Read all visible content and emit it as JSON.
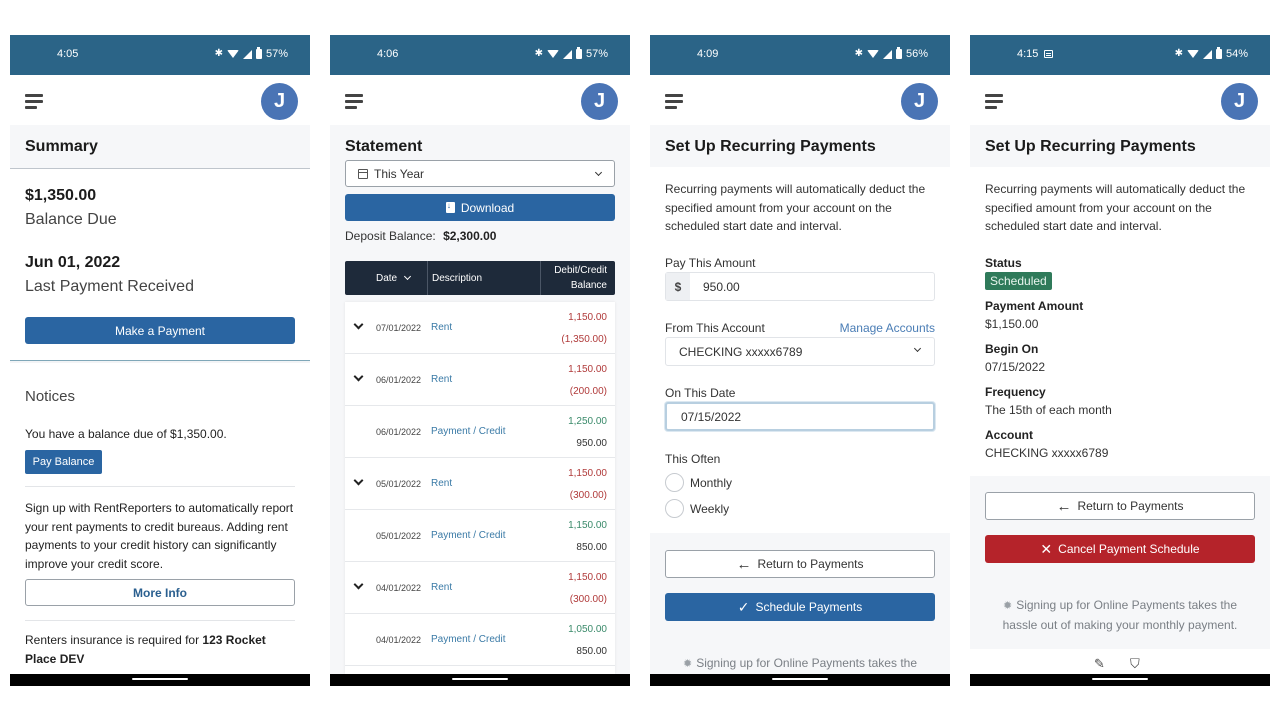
{
  "screens": [
    {
      "status": {
        "time": "4:05",
        "battery": "57%",
        "notification_icon": null
      },
      "avatar_initial": "J",
      "title": "Summary",
      "balance_amount": "$1,350.00",
      "balance_label": "Balance Due",
      "last_payment_date": "Jun 01, 2022",
      "last_payment_label": "Last Payment Received",
      "make_payment_label": "Make a Payment",
      "notices": {
        "title": "Notices",
        "balance_notice": "You have a balance due of $1,350.00.",
        "pay_balance_label": "Pay Balance",
        "rentreporters_text": "Sign up with RentReporters to automatically report your rent payments to credit bureaus. Adding rent payments to your credit history can significantly improve your credit score.",
        "more_info_label": "More Info",
        "insurance_prefix": "Renters insurance is required for ",
        "insurance_property": "123 Rocket Place DEV"
      }
    },
    {
      "status": {
        "time": "4:06",
        "battery": "57%"
      },
      "avatar_initial": "J",
      "title": "Statement",
      "period_select": {
        "value": "This Year",
        "icon": "calendar-icon"
      },
      "download_label": "Download",
      "deposit_label": "Deposit Balance:",
      "deposit_value": "$2,300.00",
      "table": {
        "headers": {
          "date": "Date",
          "description": "Description",
          "amount_line1": "Debit/Credit",
          "amount_line2": "Balance"
        },
        "rows": [
          {
            "date": "07/01/2022",
            "desc": "Rent",
            "amount": "1,150.00",
            "amount_type": "debit",
            "balance": "(1,350.00)",
            "balance_type": "negative",
            "expandable": true
          },
          {
            "date": "06/01/2022",
            "desc": "Rent",
            "amount": "1,150.00",
            "amount_type": "debit",
            "balance": "(200.00)",
            "balance_type": "negative",
            "expandable": true
          },
          {
            "date": "06/01/2022",
            "desc": "Payment / Credit",
            "amount": "1,250.00",
            "amount_type": "credit",
            "balance": "950.00",
            "balance_type": "positive",
            "expandable": false
          },
          {
            "date": "05/01/2022",
            "desc": "Rent",
            "amount": "1,150.00",
            "amount_type": "debit",
            "balance": "(300.00)",
            "balance_type": "negative",
            "expandable": true
          },
          {
            "date": "05/01/2022",
            "desc": "Payment / Credit",
            "amount": "1,150.00",
            "amount_type": "credit",
            "balance": "850.00",
            "balance_type": "positive",
            "expandable": false
          },
          {
            "date": "04/01/2022",
            "desc": "Rent",
            "amount": "1,150.00",
            "amount_type": "debit",
            "balance": "(300.00)",
            "balance_type": "negative",
            "expandable": true
          },
          {
            "date": "04/01/2022",
            "desc": "Payment / Credit",
            "amount": "1,050.00",
            "amount_type": "credit",
            "balance": "850.00",
            "balance_type": "positive",
            "expandable": false
          }
        ]
      }
    },
    {
      "status": {
        "time": "4:09",
        "battery": "56%"
      },
      "avatar_initial": "J",
      "title": "Set Up Recurring Payments",
      "intro": "Recurring payments will automatically deduct the specified amount from your account on the scheduled start date and interval.",
      "amount_label": "Pay This Amount",
      "currency_prefix": "$",
      "amount_value": "950.00",
      "account_label": "From This Account",
      "manage_accounts_label": "Manage Accounts",
      "account_value": "CHECKING xxxxx6789",
      "date_label": "On This Date",
      "date_value": "07/15/2022",
      "frequency_label": "This Often",
      "frequency_options": [
        {
          "label": "Monthly",
          "selected": false
        },
        {
          "label": "Weekly",
          "selected": false
        }
      ],
      "return_label": "Return to Payments",
      "schedule_label": "Schedule Payments",
      "tip": "Signing up for Online Payments takes the"
    },
    {
      "status": {
        "time": "4:15",
        "battery": "54%",
        "notification_icon": "message-icon"
      },
      "avatar_initial": "J",
      "title": "Set Up Recurring Payments",
      "intro": "Recurring payments will automatically deduct the specified amount from your account on the scheduled start date and interval.",
      "details": {
        "status_label": "Status",
        "status_value": "Scheduled",
        "amount_label": "Payment Amount",
        "amount_value": "$1,150.00",
        "begin_label": "Begin On",
        "begin_value": "07/15/2022",
        "frequency_label": "Frequency",
        "frequency_value": "The 15th of each month",
        "account_label": "Account",
        "account_value": "CHECKING xxxxx6789"
      },
      "return_label": "Return to Payments",
      "cancel_label": "Cancel Payment Schedule",
      "tip": "Signing up for Online Payments takes the hassle out of making your monthly payment."
    }
  ],
  "colors": {
    "statusbar": "#2b6487",
    "primary": "#2a65a2",
    "avatar": "#4a74b5",
    "table_header": "#1e2a3a",
    "debit_red": "#b03a3a",
    "credit_green": "#3a8a6a",
    "link": "#3a7aa6",
    "badge_green": "#2f7a5a",
    "danger": "#b5232a"
  }
}
